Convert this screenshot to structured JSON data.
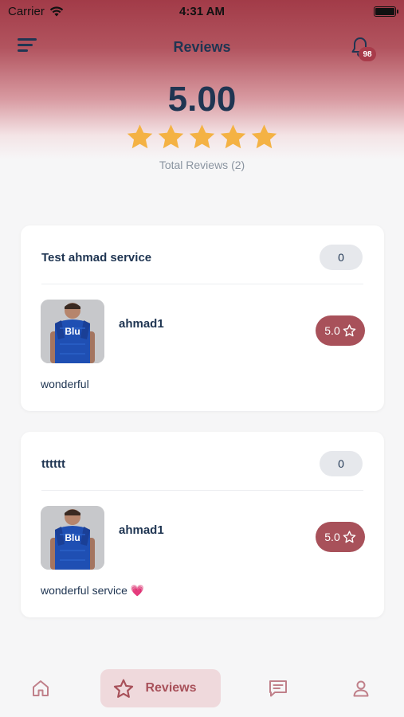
{
  "status_bar": {
    "carrier": "Carrier",
    "time": "4:31 AM"
  },
  "header": {
    "title": "Reviews",
    "notification_count": "98"
  },
  "summary": {
    "rating": "5.00",
    "stars": 5,
    "total_reviews": "Total Reviews (2)"
  },
  "reviews": [
    {
      "service": "Test ahmad service",
      "count": "0",
      "reviewer": "ahmad1",
      "score": "5.0",
      "comment": "wonderful"
    },
    {
      "service": "tttttt",
      "count": "0",
      "reviewer": "ahmad1",
      "score": "5.0",
      "comment": "wonderful service 💗"
    }
  ],
  "bottom_nav": {
    "items": [
      {
        "icon": "home-icon"
      },
      {
        "icon": "star-icon",
        "label": "Reviews",
        "active": true
      },
      {
        "icon": "chat-icon"
      },
      {
        "icon": "user-icon"
      }
    ]
  },
  "colors": {
    "accent": "#a8515a",
    "star": "#f4b244",
    "text": "#1f3552",
    "header_gradient": "#a23b48"
  }
}
